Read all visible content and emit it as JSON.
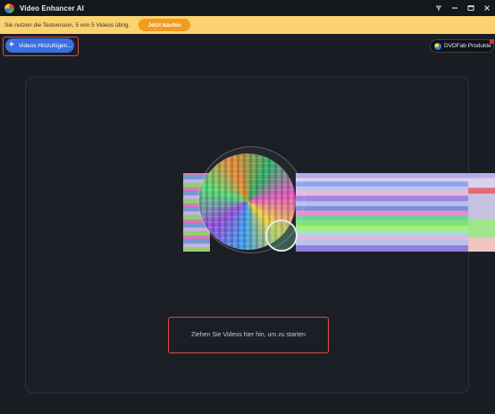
{
  "window": {
    "title": "Video Enhancer AI",
    "controls": {
      "pin_icon": "pin-icon",
      "minimize_icon": "minimize-icon",
      "maximize_icon": "maximize-icon",
      "close_icon": "close-icon"
    }
  },
  "banner": {
    "text": "Sie nutzen die Testversion, 5 von 5 Videos übrig.",
    "buy_label": "Jetzt kaufen",
    "color": "#fbd270",
    "button_color": "#f49a1c"
  },
  "toolbar": {
    "add_label": "Videos Hinzufügen...",
    "add_icon": "plus-icon",
    "products_label": "DVDFab Produkte",
    "products_icon": "dvdfab-logo-icon",
    "accent": "#3a6fe4"
  },
  "dropzone": {
    "hint": "Ziehen Sie Videos hier hin, um zu starten"
  }
}
